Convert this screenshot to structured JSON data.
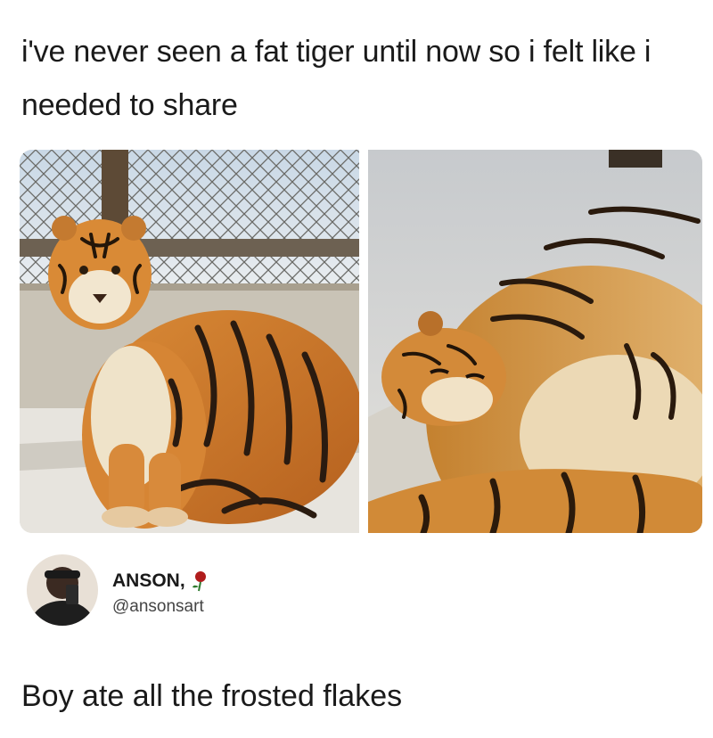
{
  "post": {
    "text": "i've never seen a fat tiger until now so i felt like i needed to share"
  },
  "photos": [
    {
      "subject": "fat tiger sitting by chain-link fence"
    },
    {
      "subject": "fat tiger lying on snowy ground"
    }
  ],
  "reply": {
    "display_name": "ANSON,",
    "name_icon": "rose-icon",
    "handle": "@ansonsart",
    "caption": "Boy ate all the frosted flakes"
  }
}
